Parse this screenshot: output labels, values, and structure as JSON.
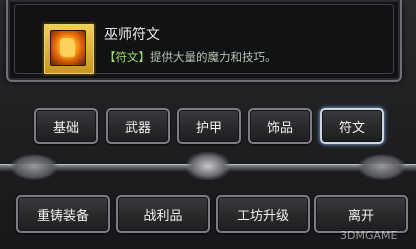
{
  "item": {
    "name": "巫师符文",
    "desc_tag": "【符文】",
    "desc_text": "提供大量的魔力和技巧。",
    "icon": "orange-rune-icon"
  },
  "tabs": [
    {
      "label": "基础",
      "active": false
    },
    {
      "label": "武器",
      "active": false
    },
    {
      "label": "护甲",
      "active": false
    },
    {
      "label": "饰品",
      "active": false
    },
    {
      "label": "符文",
      "active": true
    }
  ],
  "actions": [
    {
      "label": "重铸装备"
    },
    {
      "label": "战利品"
    },
    {
      "label": "工坊升级"
    },
    {
      "label": "离开"
    }
  ],
  "watermark": "3DMGAME"
}
